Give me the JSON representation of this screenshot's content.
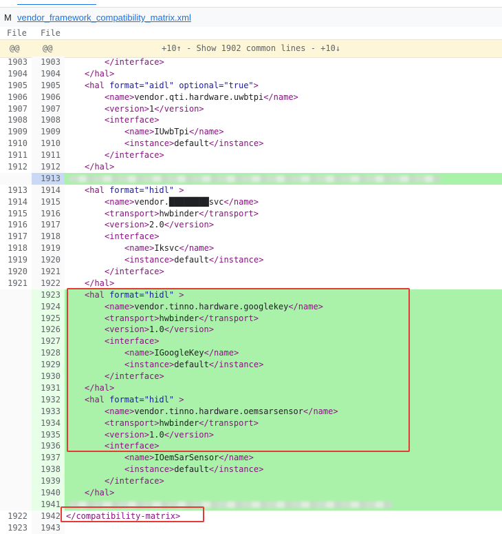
{
  "file": {
    "mode": "M",
    "name": "vendor_framework_compatibility_matrix.xml"
  },
  "columns": {
    "left": "File",
    "right": "File"
  },
  "skip": {
    "left": "@@",
    "right": "@@",
    "text": "+10↑  -  Show 1902 common lines  -  +10↓"
  },
  "rows": [
    {
      "l": "1903",
      "r": "1903",
      "type": "plain",
      "indent": 2,
      "code": [
        [
          "t",
          "</interface>"
        ]
      ]
    },
    {
      "l": "1904",
      "r": "1904",
      "type": "plain",
      "indent": 1,
      "code": [
        [
          "t",
          "</hal>"
        ]
      ]
    },
    {
      "l": "1905",
      "r": "1905",
      "type": "plain",
      "indent": 1,
      "code": [
        [
          "t",
          "<hal "
        ],
        [
          "a",
          "format="
        ],
        [
          "v",
          "\"aidl\""
        ],
        [
          "a",
          " optional="
        ],
        [
          "v",
          "\"true\""
        ],
        [
          "t",
          ">"
        ]
      ]
    },
    {
      "l": "1906",
      "r": "1906",
      "type": "plain",
      "indent": 2,
      "code": [
        [
          "t",
          "<name>"
        ],
        [
          "x",
          "vendor.qti.hardware.uwbtpi"
        ],
        [
          "t",
          "</name>"
        ]
      ]
    },
    {
      "l": "1907",
      "r": "1907",
      "type": "plain",
      "indent": 2,
      "code": [
        [
          "t",
          "<version>"
        ],
        [
          "x",
          "1"
        ],
        [
          "t",
          "</version>"
        ]
      ]
    },
    {
      "l": "1908",
      "r": "1908",
      "type": "plain",
      "indent": 2,
      "code": [
        [
          "t",
          "<interface>"
        ]
      ]
    },
    {
      "l": "1909",
      "r": "1909",
      "type": "plain",
      "indent": 3,
      "code": [
        [
          "t",
          "<name>"
        ],
        [
          "x",
          "IUwbTpi"
        ],
        [
          "t",
          "</name>"
        ]
      ]
    },
    {
      "l": "1910",
      "r": "1910",
      "type": "plain",
      "indent": 3,
      "code": [
        [
          "t",
          "<instance>"
        ],
        [
          "x",
          "default"
        ],
        [
          "t",
          "</instance>"
        ]
      ]
    },
    {
      "l": "1911",
      "r": "1911",
      "type": "plain",
      "indent": 2,
      "code": [
        [
          "t",
          "</interface>"
        ]
      ]
    },
    {
      "l": "1912",
      "r": "1912",
      "type": "plain",
      "indent": 1,
      "code": [
        [
          "t",
          "</hal>"
        ]
      ]
    },
    {
      "l": "",
      "r": "1913",
      "type": "hl",
      "indent": 0,
      "code": [],
      "blur": true
    },
    {
      "l": "1913",
      "r": "1914",
      "type": "plain",
      "indent": 1,
      "code": [
        [
          "t",
          "<hal "
        ],
        [
          "a",
          "format="
        ],
        [
          "v",
          "\"hidl\""
        ],
        [
          "t",
          " >"
        ]
      ]
    },
    {
      "l": "1914",
      "r": "1915",
      "type": "plain",
      "indent": 2,
      "code": [
        [
          "t",
          "<name>"
        ],
        [
          "x",
          "vendor.████████svc"
        ],
        [
          "t",
          "</name>"
        ]
      ]
    },
    {
      "l": "1915",
      "r": "1916",
      "type": "plain",
      "indent": 2,
      "code": [
        [
          "t",
          "<transport>"
        ],
        [
          "x",
          "hwbinder"
        ],
        [
          "t",
          "</transport>"
        ]
      ]
    },
    {
      "l": "1916",
      "r": "1917",
      "type": "plain",
      "indent": 2,
      "code": [
        [
          "t",
          "<version>"
        ],
        [
          "x",
          "2.0"
        ],
        [
          "t",
          "</version>"
        ]
      ]
    },
    {
      "l": "1917",
      "r": "1918",
      "type": "plain",
      "indent": 2,
      "code": [
        [
          "t",
          "<interface>"
        ]
      ]
    },
    {
      "l": "1918",
      "r": "1919",
      "type": "plain",
      "indent": 3,
      "code": [
        [
          "t",
          "<name>"
        ],
        [
          "x",
          "Iksvc"
        ],
        [
          "t",
          "</name>"
        ]
      ]
    },
    {
      "l": "1919",
      "r": "1920",
      "type": "plain",
      "indent": 3,
      "code": [
        [
          "t",
          "<instance>"
        ],
        [
          "x",
          "default"
        ],
        [
          "t",
          "</instance>"
        ]
      ]
    },
    {
      "l": "1920",
      "r": "1921",
      "type": "plain",
      "indent": 2,
      "code": [
        [
          "t",
          "</interface>"
        ]
      ]
    },
    {
      "l": "1921",
      "r": "1922",
      "type": "plain",
      "indent": 1,
      "code": [
        [
          "t",
          "</hal>"
        ]
      ]
    },
    {
      "l": "",
      "r": "1923",
      "type": "added",
      "indent": 1,
      "code": [
        [
          "t",
          "<hal "
        ],
        [
          "a",
          "format="
        ],
        [
          "v",
          "\"hidl\""
        ],
        [
          "t",
          " >"
        ]
      ]
    },
    {
      "l": "",
      "r": "1924",
      "type": "added",
      "indent": 2,
      "code": [
        [
          "t",
          "<name>"
        ],
        [
          "x",
          "vendor.tinno.hardware.googlekey"
        ],
        [
          "t",
          "</name>"
        ]
      ]
    },
    {
      "l": "",
      "r": "1925",
      "type": "added",
      "indent": 2,
      "code": [
        [
          "t",
          "<transport>"
        ],
        [
          "x",
          "hwbinder"
        ],
        [
          "t",
          "</transport>"
        ]
      ]
    },
    {
      "l": "",
      "r": "1926",
      "type": "added",
      "indent": 2,
      "code": [
        [
          "t",
          "<version>"
        ],
        [
          "x",
          "1.0"
        ],
        [
          "t",
          "</version>"
        ]
      ]
    },
    {
      "l": "",
      "r": "1927",
      "type": "added",
      "indent": 2,
      "code": [
        [
          "t",
          "<interface>"
        ]
      ]
    },
    {
      "l": "",
      "r": "1928",
      "type": "added",
      "indent": 3,
      "code": [
        [
          "t",
          "<name>"
        ],
        [
          "x",
          "IGoogleKey"
        ],
        [
          "t",
          "</name>"
        ]
      ]
    },
    {
      "l": "",
      "r": "1929",
      "type": "added",
      "indent": 3,
      "code": [
        [
          "t",
          "<instance>"
        ],
        [
          "x",
          "default"
        ],
        [
          "t",
          "</instance>"
        ]
      ]
    },
    {
      "l": "",
      "r": "1930",
      "type": "added",
      "indent": 2,
      "code": [
        [
          "t",
          "</interface>"
        ]
      ]
    },
    {
      "l": "",
      "r": "1931",
      "type": "added",
      "indent": 1,
      "code": [
        [
          "t",
          "</hal>"
        ]
      ]
    },
    {
      "l": "",
      "r": "1932",
      "type": "added",
      "indent": 1,
      "code": [
        [
          "t",
          "<hal "
        ],
        [
          "a",
          "format="
        ],
        [
          "v",
          "\"hidl\""
        ],
        [
          "t",
          " >"
        ]
      ]
    },
    {
      "l": "",
      "r": "1933",
      "type": "added",
      "indent": 2,
      "code": [
        [
          "t",
          "<name>"
        ],
        [
          "x",
          "vendor.tinno.hardware.oemsarsensor"
        ],
        [
          "t",
          "</name>"
        ]
      ]
    },
    {
      "l": "",
      "r": "1934",
      "type": "added",
      "indent": 2,
      "code": [
        [
          "t",
          "<transport>"
        ],
        [
          "x",
          "hwbinder"
        ],
        [
          "t",
          "</transport>"
        ]
      ]
    },
    {
      "l": "",
      "r": "1935",
      "type": "added",
      "indent": 2,
      "code": [
        [
          "t",
          "<version>"
        ],
        [
          "x",
          "1.0"
        ],
        [
          "t",
          "</version>"
        ]
      ]
    },
    {
      "l": "",
      "r": "1936",
      "type": "added",
      "indent": 2,
      "code": [
        [
          "t",
          "<interface>"
        ]
      ]
    },
    {
      "l": "",
      "r": "1937",
      "type": "added",
      "indent": 3,
      "code": [
        [
          "t",
          "<name>"
        ],
        [
          "x",
          "IOemSarSensor"
        ],
        [
          "t",
          "</name>"
        ]
      ]
    },
    {
      "l": "",
      "r": "1938",
      "type": "added",
      "indent": 3,
      "code": [
        [
          "t",
          "<instance>"
        ],
        [
          "x",
          "default"
        ],
        [
          "t",
          "</instance>"
        ]
      ]
    },
    {
      "l": "",
      "r": "1939",
      "type": "added",
      "indent": 2,
      "code": [
        [
          "t",
          "</interface>"
        ]
      ]
    },
    {
      "l": "",
      "r": "1940",
      "type": "added",
      "indent": 1,
      "code": [
        [
          "t",
          "</hal>"
        ]
      ]
    },
    {
      "l": "",
      "r": "1941",
      "type": "added",
      "indent": 0,
      "code": [],
      "blur": true
    },
    {
      "l": "1922",
      "r": "1942",
      "type": "plain",
      "indent": 0,
      "code": [
        [
          "t",
          "</compatibility-matrix>"
        ]
      ]
    },
    {
      "l": "1923",
      "r": "1943",
      "type": "plain",
      "indent": 0,
      "code": []
    }
  ],
  "colors": {
    "added": "#aaf2aa",
    "tag": "#881280",
    "attr": "#1a1aa6",
    "highlight_box": "#e53935"
  }
}
